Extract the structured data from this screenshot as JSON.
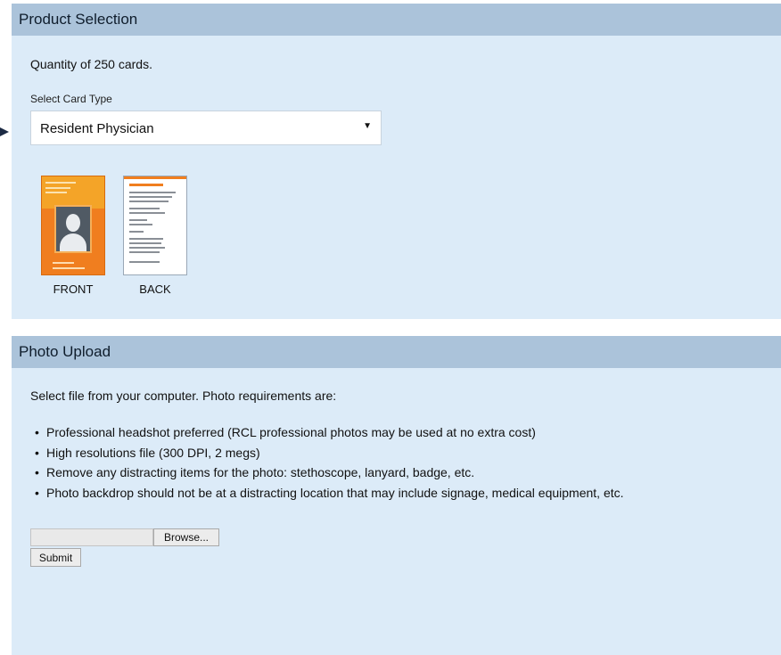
{
  "product_selection": {
    "header": "Product Selection",
    "quantity_text": "Quantity of 250 cards.",
    "select_label": "Select Card Type",
    "selected_card_type": "Resident Physician",
    "front_caption": "FRONT",
    "back_caption": "BACK"
  },
  "photo_upload": {
    "header": "Photo Upload",
    "intro": "Select file from your computer. Photo requirements are:",
    "requirements": [
      "Professional headshot preferred (RCL professional photos may be used at no extra cost)",
      "High resolutions file (300 DPI, 2 megs)",
      "Remove any distracting items for the photo: stethoscope, lanyard, badge, etc.",
      "Photo backdrop should not be at a distracting location that may include signage, medical equipment, etc."
    ],
    "browse_label": "Browse...",
    "submit_label": "Submit"
  },
  "icons": {
    "pointer": "arrow-right-icon",
    "dropdown": "chevron-down-icon"
  }
}
